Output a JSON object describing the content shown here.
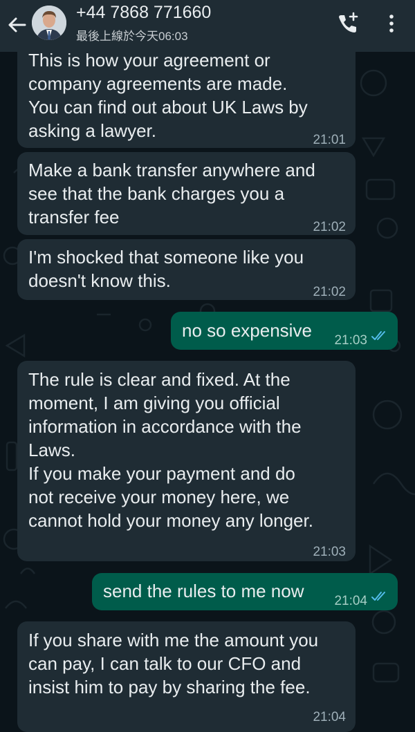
{
  "header": {
    "contact_name": "+44 7868 771660",
    "last_seen": "最後上線於今天06:03"
  },
  "messages": [
    {
      "direction": "in",
      "text": "This is how your agreement or\ncompany agreements are made.\nYou can find out about UK Laws by\nasking a lawyer.",
      "time": "21:01"
    },
    {
      "direction": "in",
      "text": "Make a bank transfer anywhere and\nsee that the bank charges you a\ntransfer fee",
      "time": "21:02"
    },
    {
      "direction": "in",
      "text": "I'm shocked that someone like you\ndoesn't know this.",
      "time": "21:02"
    },
    {
      "direction": "out",
      "text": "no so expensive",
      "time": "21:03",
      "status": "read"
    },
    {
      "direction": "in",
      "text": "The rule is clear and fixed. At the\nmoment, I am giving you official\ninformation in accordance with the\nLaws.\nIf you make your payment and do\nnot receive your money here, we\ncannot hold your money any longer.",
      "time": "21:03"
    },
    {
      "direction": "out",
      "text": "send the rules to me now",
      "time": "21:04",
      "status": "read"
    },
    {
      "direction": "in",
      "text": "If you share with me the amount you\ncan pay, I can talk to our CFO and\ninsist him to pay by sharing the fee.",
      "time": "21:04"
    }
  ],
  "colors": {
    "background": "#0b141a",
    "header": "#1f2c34",
    "incoming_bubble": "#1f2c34",
    "outgoing_bubble": "#005c4b",
    "read_ticks": "#53bdeb"
  }
}
